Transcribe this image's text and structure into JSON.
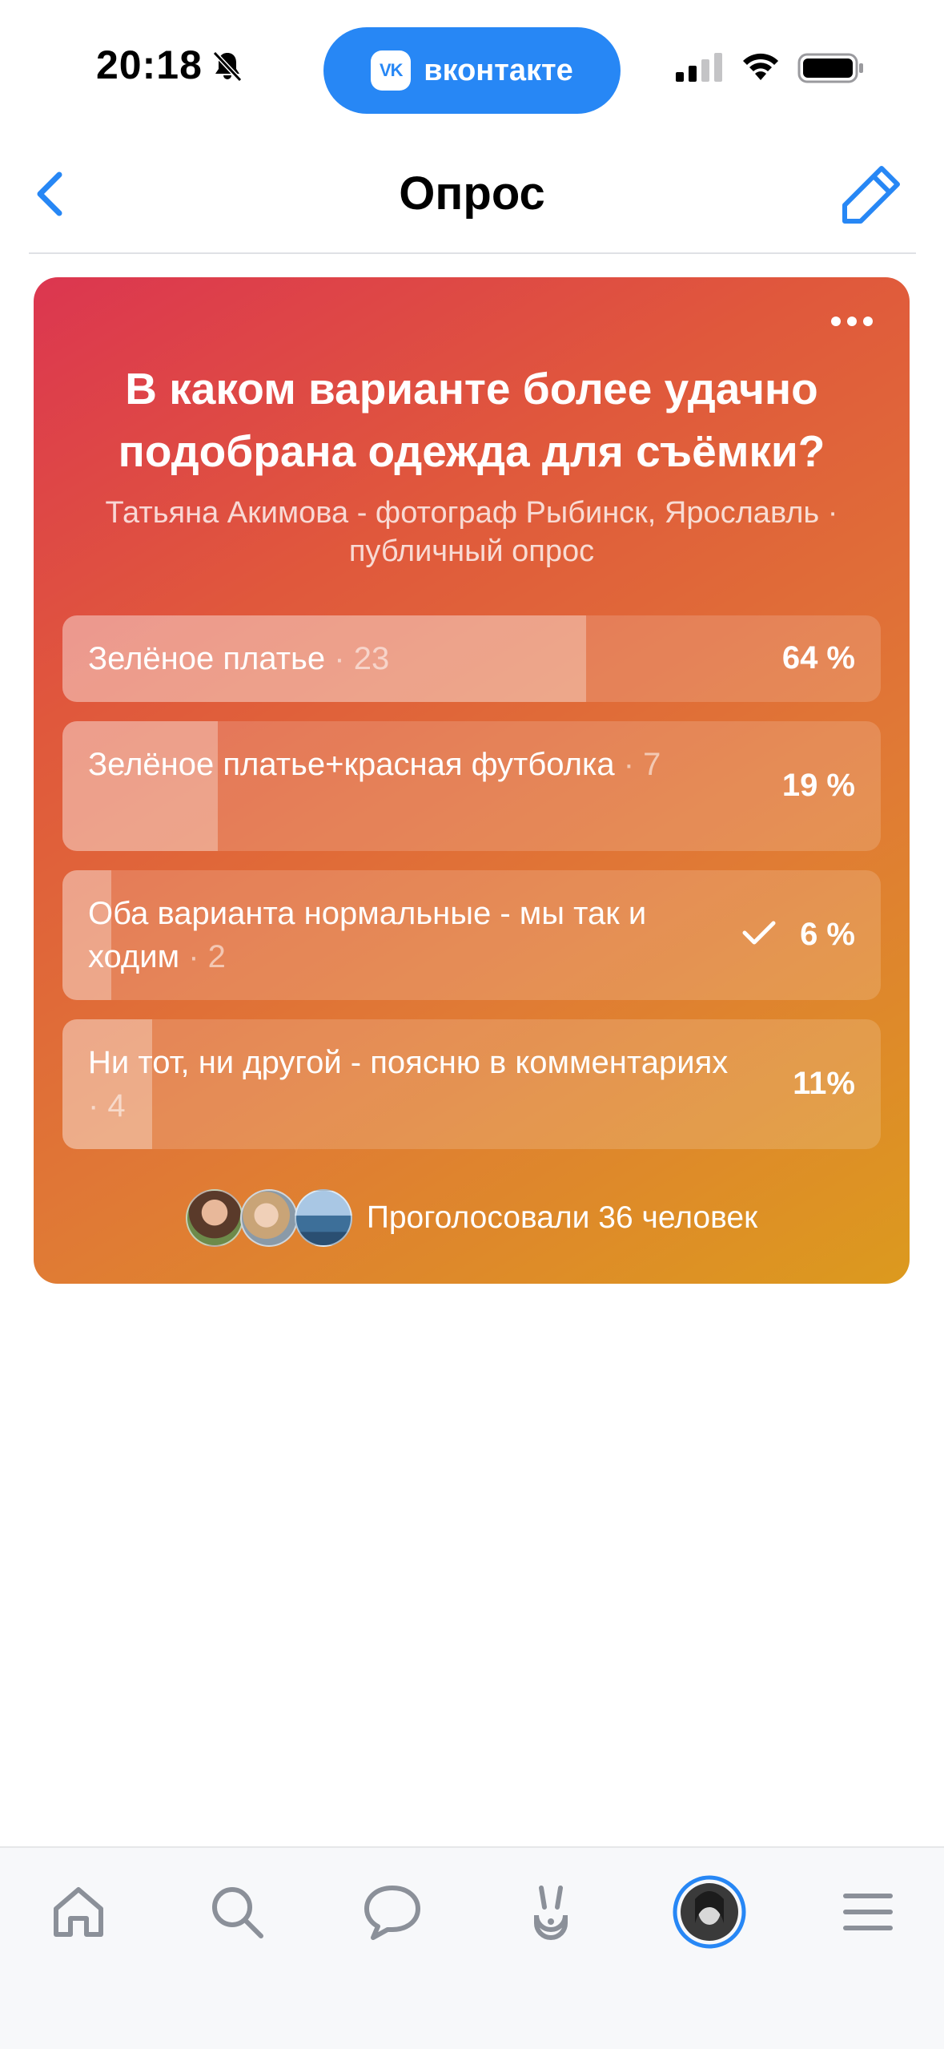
{
  "status_bar": {
    "time": "20:18",
    "app_pill_label": "вконтакте",
    "app_logo_text": "VK",
    "icons": [
      "bell-slash-icon",
      "signal-icon",
      "wifi-icon",
      "battery-icon"
    ]
  },
  "nav": {
    "title": "Опрос",
    "back_icon": "chevron-left-icon",
    "edit_icon": "pencil-icon"
  },
  "poll": {
    "question": "В каком варианте более удачно подобрана одежда для съёмки?",
    "meta": "Татьяна Акимова -  фотограф  Рыбинск, Ярославль · публичный опрос",
    "options": [
      {
        "label": "Зелёное платье",
        "votes": "· 23",
        "percent": "64 %",
        "fraction": 0.64,
        "checked": false
      },
      {
        "label": "Зелёное платье+красная футболка",
        "votes": "· 7",
        "percent": "19 %",
        "fraction": 0.19,
        "checked": false
      },
      {
        "label": "Оба варианта  нормальные - мы так и ходим",
        "votes": "· 2",
        "percent": "6 %",
        "fraction": 0.06,
        "checked": true
      },
      {
        "label": "Ни тот, ни другой - поясню в комментариях",
        "votes": "· 4",
        "percent": "11%",
        "fraction": 0.11,
        "checked": false
      }
    ],
    "voters_text": "Проголосовали 36 человек"
  },
  "tabbar": {
    "items": [
      "home-icon",
      "search-icon",
      "messages-icon",
      "clips-icon",
      "profile-avatar",
      "menu-icon"
    ],
    "accent": "#2787f5"
  },
  "colors": {
    "accent": "#2787f5",
    "gradient_start": "#dc3650",
    "gradient_end": "#dc9a1e"
  }
}
